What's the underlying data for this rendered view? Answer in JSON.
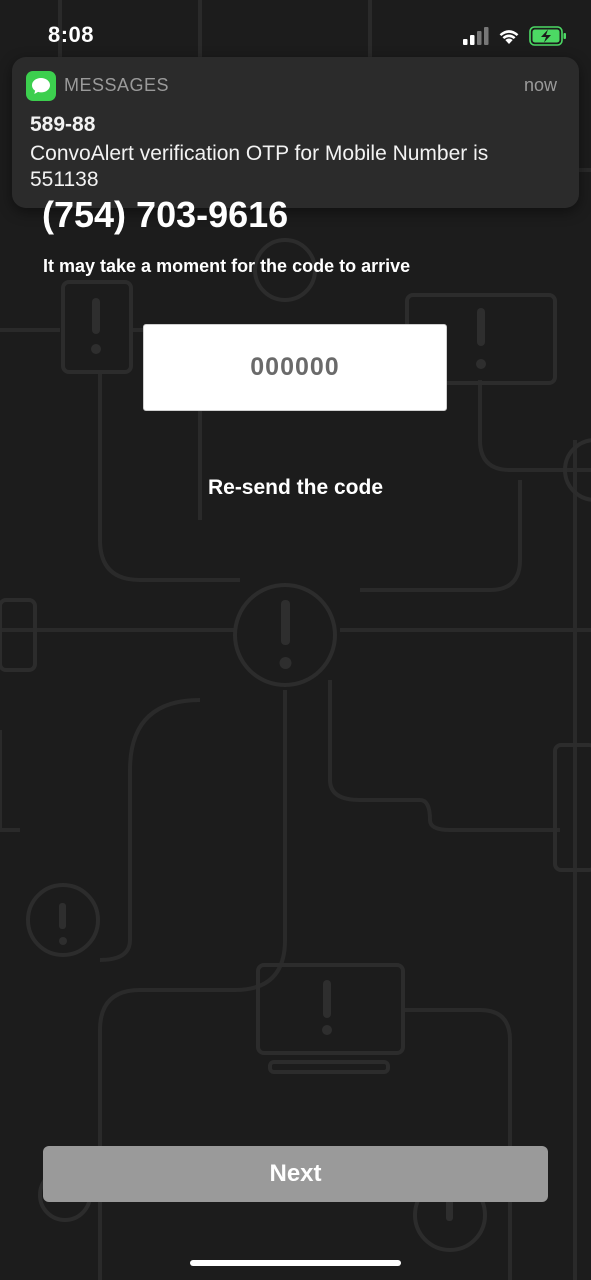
{
  "status_bar": {
    "time": "8:08"
  },
  "notification": {
    "app_name": "MESSAGES",
    "time": "now",
    "sender": "589-88",
    "body": "ConvoAlert verification OTP for Mobile Number is 551138"
  },
  "verify": {
    "phone_number": "(754) 703-9616",
    "hint": "It may take a moment for the code to arrive",
    "code_placeholder": "000000",
    "resend_label": "Re-send the code",
    "next_label": "Next"
  },
  "colors": {
    "background": "#1c1c1c",
    "pattern_stroke": "#2b2b2b",
    "messages_green": "#3ccf4e",
    "battery_green": "#4cd964",
    "next_button_disabled": "#9a9a9a"
  }
}
